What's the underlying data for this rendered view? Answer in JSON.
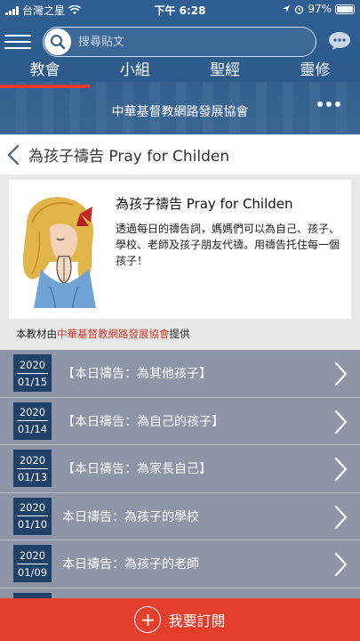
{
  "status": {
    "carrier": "台灣之星",
    "time": "下午 6:28",
    "battery": "97%"
  },
  "search": {
    "placeholder": "搜尋貼文"
  },
  "tabs": [
    {
      "label": "教會"
    },
    {
      "label": "小組"
    },
    {
      "label": "聖經"
    },
    {
      "label": "靈修"
    }
  ],
  "org_bar": {
    "title": "中華基督教網路發展協會"
  },
  "page": {
    "title": "為孩子禱告 Pray for Childen"
  },
  "intro": {
    "title": "為孩子禱告 Pray for Childen",
    "description": "透過每日的禱告詞，媽媽們可以為自己、孩子、學校、老師及孩子朋友代禱。用禱告托住每一個孩子！",
    "provider_prefix": "本教材由",
    "provider_org": "中華基督教網路發展協會",
    "provider_suffix": "提供"
  },
  "items": [
    {
      "year": "2020",
      "md": "01/15",
      "label": "【本日禱告：為其他孩子】"
    },
    {
      "year": "2020",
      "md": "01/14",
      "label": "【本日禱告：為自己的孩子】"
    },
    {
      "year": "2020",
      "md": "01/13",
      "label": "【本日禱告：為家長自己】"
    },
    {
      "year": "2020",
      "md": "01/10",
      "label": "本日禱告：為孩子的學校"
    },
    {
      "year": "2020",
      "md": "01/09",
      "label": "本日禱告：為孩子的老師"
    }
  ],
  "subscribe": {
    "label": "我要訂閱"
  },
  "colors": {
    "header_blue": "#2d5c8e",
    "accent_red": "#e43f2d",
    "date_navy": "#1f4067",
    "item_gray": "#8e95a6"
  }
}
